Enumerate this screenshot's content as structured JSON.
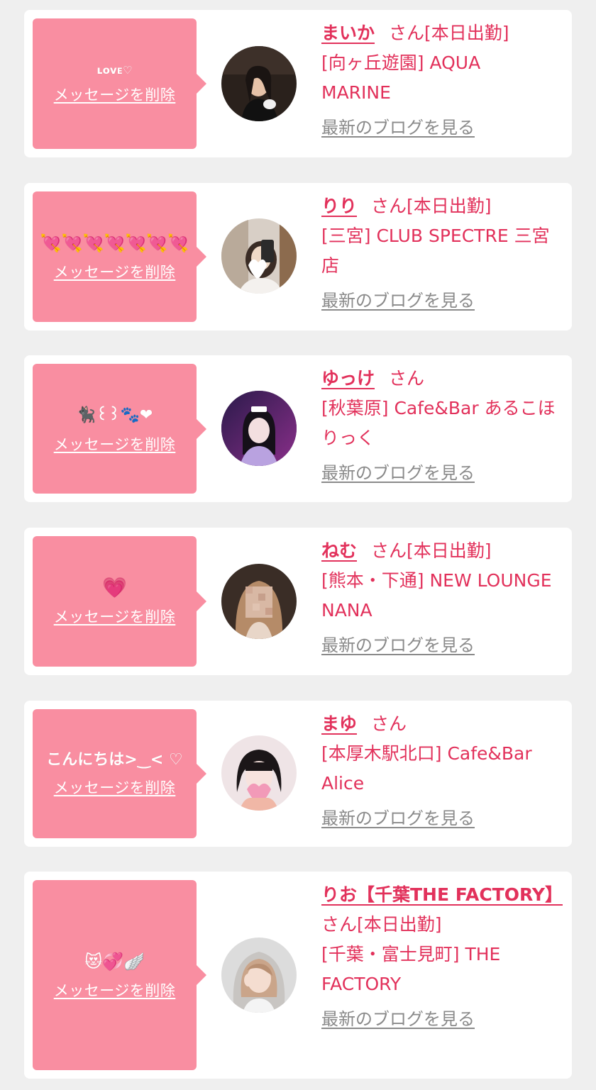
{
  "delete_label": "メッセージを削除",
  "blog_label": "最新のブログを見る",
  "honorific": "さん",
  "colors": {
    "message_bg": "#f98ea1",
    "accent": "#e2315b",
    "link_gray": "#8a8a8a",
    "page_bg": "#efefef"
  },
  "cards": [
    {
      "message": "ʟᴏᴠᴇ♡",
      "name": "まいか",
      "status": "[本日出勤]",
      "shop": "[向ヶ丘遊園] AQUA MARINE",
      "avatar_icon": "cast-photo"
    },
    {
      "message": "💘💘💘💘💘💘💘",
      "name": "りり",
      "status": "[本日出勤]",
      "shop": "[三宮] CLUB SPECTRE 三宮店",
      "avatar_icon": "cast-photo"
    },
    {
      "message": "🐈‍⬛꒰꒱🐾❤",
      "name": "ゆっけ",
      "status": "",
      "shop": "[秋葉原] Cafe&Bar あるこほりっく",
      "avatar_icon": "cast-photo"
    },
    {
      "message": "💗",
      "name": "ねむ",
      "status": "[本日出勤]",
      "shop": "[熊本・下通] NEW LOUNGE NANA",
      "avatar_icon": "cast-photo"
    },
    {
      "message": "こんにちは>‿< ♡",
      "name": "まゆ",
      "status": "",
      "shop": "[本厚木駅北口] Cafe&Bar Alice",
      "avatar_icon": "cast-photo"
    },
    {
      "message": "😻💞🪽",
      "name": "りお【千葉THE FACTORY】",
      "status": "[本日出勤]",
      "shop": "[千葉・富士見町] THE FACTORY",
      "avatar_icon": "cast-photo"
    }
  ]
}
